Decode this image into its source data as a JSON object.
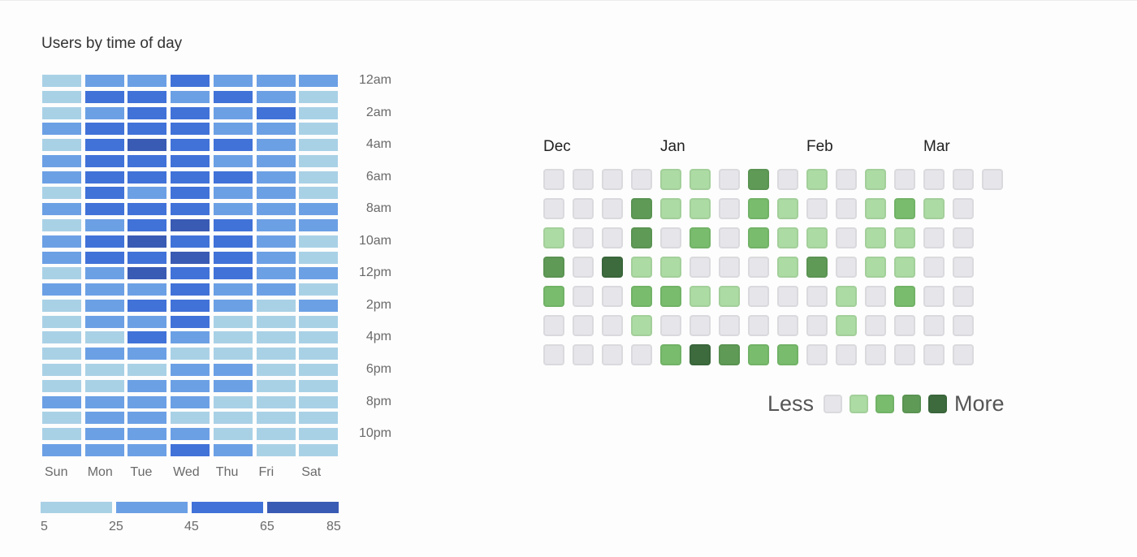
{
  "chart_data": [
    {
      "type": "heatmap",
      "title": "Users by time of day",
      "x_categories": [
        "Sun",
        "Mon",
        "Tue",
        "Wed",
        "Thu",
        "Fri",
        "Sat"
      ],
      "y_categories": [
        "12am",
        "1am",
        "2am",
        "3am",
        "4am",
        "5am",
        "6am",
        "7am",
        "8am",
        "9am",
        "10am",
        "11am",
        "12pm",
        "1pm",
        "2pm",
        "3pm",
        "4pm",
        "5pm",
        "6pm",
        "7pm",
        "8pm",
        "9pm",
        "10pm",
        "11pm"
      ],
      "y_tick_labels": [
        "12am",
        "2am",
        "4am",
        "6am",
        "8am",
        "10am",
        "12pm",
        "2pm",
        "4pm",
        "6pm",
        "8pm",
        "10pm"
      ],
      "bins": [
        {
          "range": [
            5,
            25
          ],
          "color": "#a9d1e6"
        },
        {
          "range": [
            25,
            45
          ],
          "color": "#6ca0e5"
        },
        {
          "range": [
            45,
            65
          ],
          "color": "#4172d8"
        },
        {
          "range": [
            65,
            85
          ],
          "color": "#3a5bb4"
        }
      ],
      "scale_ticks": [
        "5",
        "25",
        "45",
        "65",
        "85"
      ],
      "value_bins_by_hour": [
        [
          1,
          2,
          2,
          3,
          2,
          2,
          2
        ],
        [
          1,
          3,
          3,
          2,
          3,
          2,
          1
        ],
        [
          1,
          2,
          3,
          3,
          2,
          3,
          1
        ],
        [
          2,
          3,
          3,
          3,
          2,
          2,
          1
        ],
        [
          1,
          3,
          4,
          3,
          3,
          2,
          1
        ],
        [
          2,
          3,
          3,
          3,
          2,
          2,
          1
        ],
        [
          2,
          3,
          3,
          3,
          3,
          2,
          1
        ],
        [
          1,
          3,
          2,
          3,
          2,
          2,
          1
        ],
        [
          2,
          3,
          3,
          3,
          2,
          2,
          2
        ],
        [
          1,
          2,
          3,
          4,
          3,
          2,
          2
        ],
        [
          2,
          3,
          4,
          3,
          3,
          2,
          1
        ],
        [
          2,
          3,
          3,
          4,
          3,
          2,
          1
        ],
        [
          1,
          2,
          4,
          3,
          3,
          2,
          2
        ],
        [
          2,
          2,
          2,
          3,
          2,
          2,
          1
        ],
        [
          1,
          2,
          3,
          3,
          2,
          1,
          2
        ],
        [
          1,
          2,
          2,
          3,
          1,
          1,
          1
        ],
        [
          1,
          1,
          3,
          2,
          1,
          1,
          1
        ],
        [
          1,
          2,
          2,
          1,
          1,
          1,
          1
        ],
        [
          1,
          1,
          1,
          2,
          2,
          1,
          1
        ],
        [
          1,
          1,
          2,
          2,
          2,
          1,
          1
        ],
        [
          2,
          2,
          2,
          2,
          1,
          1,
          1
        ],
        [
          1,
          2,
          2,
          1,
          1,
          1,
          1
        ],
        [
          1,
          2,
          2,
          2,
          1,
          1,
          1
        ],
        [
          2,
          2,
          2,
          3,
          2,
          1,
          1
        ]
      ]
    },
    {
      "type": "heatmap",
      "title": "",
      "month_labels": [
        {
          "label": "Dec",
          "week": 0
        },
        {
          "label": "Jan",
          "week": 4
        },
        {
          "label": "Feb",
          "week": 9
        },
        {
          "label": "Mar",
          "week": 13
        }
      ],
      "levels": [
        {
          "level": 0,
          "color": "#e6e6ea"
        },
        {
          "level": 1,
          "color": "#acdba3"
        },
        {
          "level": 2,
          "color": "#79bc6d"
        },
        {
          "level": 3,
          "color": "#5f9b57"
        },
        {
          "level": 4,
          "color": "#3d6b3e"
        }
      ],
      "legend": {
        "less": "Less",
        "more": "More"
      },
      "rows_by_weekday": [
        [
          0,
          0,
          0,
          0,
          1,
          1,
          0,
          3,
          0,
          1,
          0,
          1,
          0,
          0,
          0,
          0
        ],
        [
          0,
          0,
          0,
          3,
          1,
          1,
          0,
          2,
          1,
          0,
          0,
          1,
          2,
          1,
          0
        ],
        [
          1,
          0,
          0,
          3,
          0,
          2,
          0,
          2,
          1,
          1,
          0,
          1,
          1,
          0,
          0
        ],
        [
          3,
          0,
          4,
          1,
          1,
          0,
          0,
          0,
          1,
          3,
          0,
          1,
          1,
          0,
          0
        ],
        [
          2,
          0,
          0,
          2,
          2,
          1,
          1,
          0,
          0,
          0,
          1,
          0,
          2,
          0,
          0
        ],
        [
          0,
          0,
          0,
          1,
          0,
          0,
          0,
          0,
          0,
          0,
          1,
          0,
          0,
          0,
          0
        ],
        [
          0,
          0,
          0,
          0,
          2,
          4,
          3,
          2,
          2,
          0,
          0,
          0,
          0,
          0,
          0
        ]
      ]
    }
  ]
}
